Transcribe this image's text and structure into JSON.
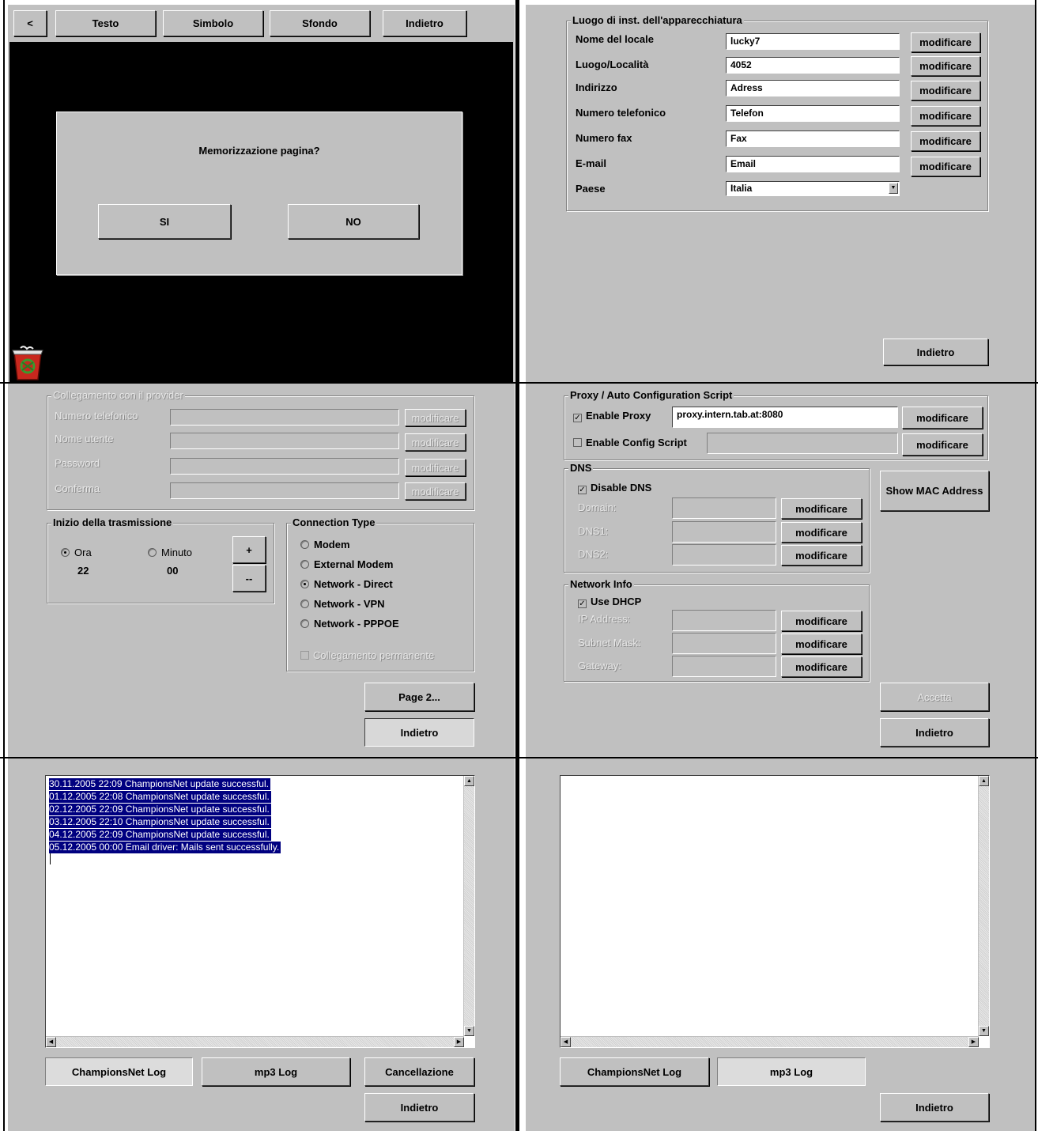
{
  "panel1": {
    "toolbar": {
      "back": "<",
      "testo": "Testo",
      "simbolo": "Simbolo",
      "sfondo": "Sfondo",
      "indietro": "Indietro"
    },
    "dialog": {
      "question": "Memorizzazione pagina?",
      "yes": "SI",
      "no": "NO"
    }
  },
  "panel2": {
    "group_title": "Luogo di inst. dell'apparecchiatura",
    "rows": [
      {
        "label": "Nome del locale",
        "value": "lucky7",
        "button": "modificare"
      },
      {
        "label": "Luogo/Località",
        "value": "4052",
        "button": "modificare"
      },
      {
        "label": "Indirizzo",
        "value": "Adress",
        "button": "modificare"
      },
      {
        "label": "Numero telefonico",
        "value": "Telefon",
        "button": "modificare"
      },
      {
        "label": "Numero fax",
        "value": "Fax",
        "button": "modificare"
      },
      {
        "label": "E-mail",
        "value": "Email",
        "button": "modificare"
      }
    ],
    "country_label": "Paese",
    "country_value": "Italia",
    "back": "Indietro"
  },
  "panel3": {
    "provider_title": "Collegamento con il provider",
    "provider_rows": [
      {
        "label": "Numero telefonico",
        "button": "modificare"
      },
      {
        "label": "Nome utente",
        "button": "modificare"
      },
      {
        "label": "Password",
        "button": "modificare"
      },
      {
        "label": "Conferma",
        "button": "modificare"
      }
    ],
    "start_title": "Inizio della trasmissione",
    "ora_label": "Ora",
    "minuto_label": "Minuto",
    "ora_value": "22",
    "minuto_value": "00",
    "plus": "+",
    "minus": "--",
    "conn_title": "Connection Type",
    "conn_options": [
      "Modem",
      "External Modem",
      "Network - Direct",
      "Network - VPN",
      "Network - PPPOE"
    ],
    "conn_selected": 2,
    "permanent": "Collegamento permanente",
    "page2": "Page 2...",
    "back": "Indietro"
  },
  "panel4": {
    "proxy_title": "Proxy / Auto Configuration Script",
    "enable_proxy": "Enable Proxy",
    "proxy_value": "proxy.intern.tab.at:8080",
    "enable_script": "Enable Config Script",
    "modify": "modificare",
    "dns_title": "DNS",
    "disable_dns": "Disable DNS",
    "dns_rows": [
      "Domain:",
      "DNS1:",
      "DNS2:"
    ],
    "mac_button": "Show MAC Address",
    "netinfo_title": "Network Info",
    "use_dhcp": "Use DHCP",
    "net_rows": [
      "IP Address:",
      "Subnet Mask:",
      "Gateway:"
    ],
    "accept": "Accetta",
    "back": "Indietro"
  },
  "panel5": {
    "log_lines": [
      "30.11.2005 22:09 ChampionsNet update successful.",
      "01.12.2005 22:08 ChampionsNet update successful.",
      "02.12.2005 22:09 ChampionsNet update successful.",
      "03.12.2005 22:10 ChampionsNet update successful.",
      "04.12.2005 22:09 ChampionsNet update successful.",
      "05.12.2005 00:00 Email driver: Mails sent successfully."
    ],
    "champions_log": "ChampionsNet Log",
    "mp3_log": "mp3 Log",
    "clear": "Cancellazione",
    "back": "Indietro"
  },
  "panel6": {
    "champions_log": "ChampionsNet Log",
    "mp3_log": "mp3 Log",
    "back": "Indietro"
  },
  "colors": {
    "panel": "#c0c0c0",
    "selection": "#000080",
    "black_area": "#000000"
  },
  "icons": [
    "trash-bin-icon"
  ]
}
